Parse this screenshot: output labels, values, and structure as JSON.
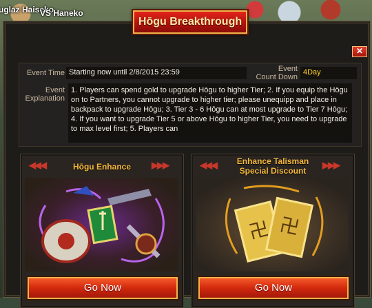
{
  "background": {
    "name_left": "uglaz Haiseko",
    "name_right": "VS Haneko"
  },
  "dialog": {
    "title": "Hōgu Breakthrough",
    "close_label": "✕"
  },
  "event": {
    "time_label": "Event Time",
    "time_value": "Starting now until 2/8/2015 23:59",
    "countdown_label_1": "Event",
    "countdown_label_2": "Count Down",
    "countdown_value": "4Day",
    "explanation_label_1": "Event",
    "explanation_label_2": "Explanation",
    "explanation_text": "1. Players can spend gold to upgrade Hōgu to higher Tier; 2. If you equip the Hōgu on to Partners, you cannot upgrade to higher tier; please unequipp and place in backpack to upgrade Hōgu; 3. Tier 3 - 6 Hōgu can at most upgrade to Tier 7 Hōgu; 4. If you want to upgrade Tier 5 or above Hōgu to higher Tier, you need to upgrade to max level first; 5. Players can"
  },
  "panels": [
    {
      "title_line1": "Hōgu Enhance",
      "title_line2": "",
      "button_label": "Go Now",
      "art_icon": "hogu-weapons-icon"
    },
    {
      "title_line1": "Enhance Talisman",
      "title_line2": "Special Discount",
      "button_label": "Go Now",
      "art_icon": "talisman-scrolls-icon"
    }
  ],
  "colors": {
    "accent_gold": "#f5b73a",
    "title_red": "#d01a10",
    "countdown_yellow": "#ffd12a"
  }
}
